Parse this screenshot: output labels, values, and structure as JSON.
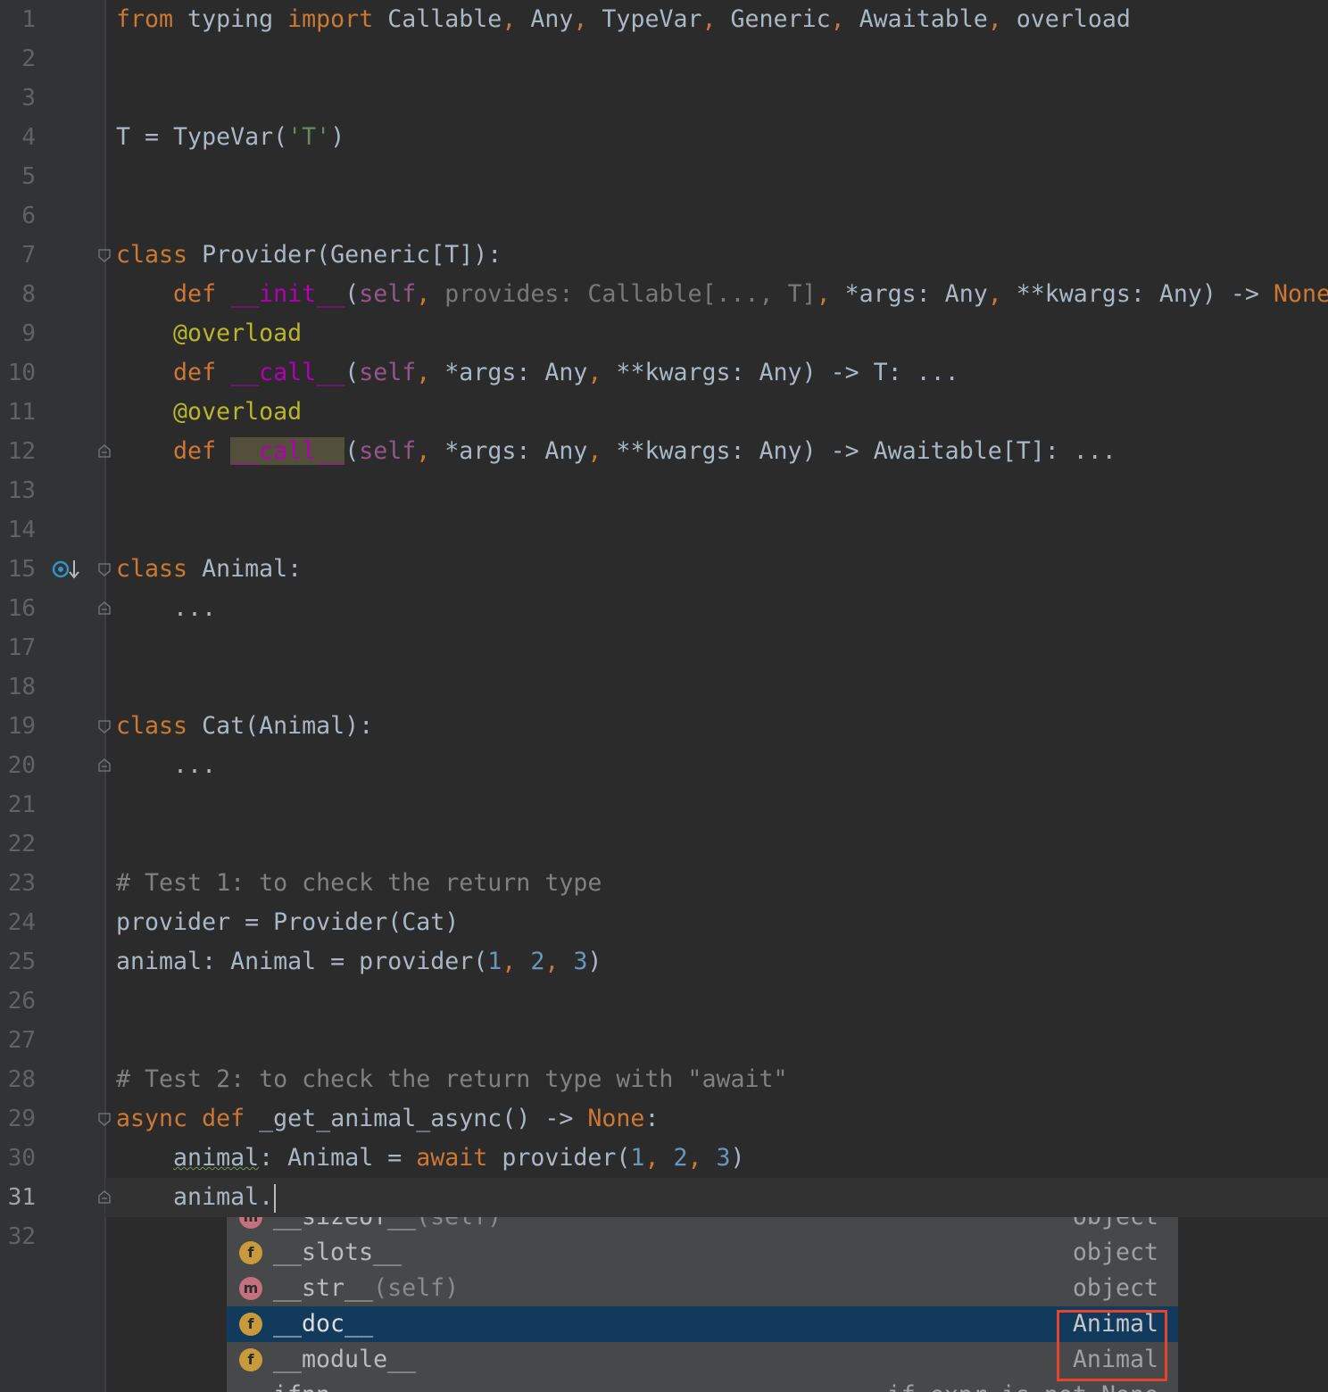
{
  "editor": {
    "line_numbers": [
      "1",
      "2",
      "3",
      "4",
      "5",
      "6",
      "7",
      "8",
      "9",
      "10",
      "11",
      "12",
      "13",
      "14",
      "15",
      "16",
      "17",
      "18",
      "19",
      "20",
      "21",
      "22",
      "23",
      "24",
      "25",
      "26",
      "27",
      "28",
      "29",
      "30",
      "31",
      "32"
    ],
    "current_line": "31",
    "lines": [
      [
        {
          "t": "from",
          "c": "kw"
        },
        {
          "t": " typing "
        },
        {
          "t": "import",
          "c": "kw"
        },
        {
          "t": " Callable"
        },
        {
          "t": ",",
          "c": "kw"
        },
        {
          "t": " Any"
        },
        {
          "t": ",",
          "c": "kw"
        },
        {
          "t": " TypeVar"
        },
        {
          "t": ",",
          "c": "kw"
        },
        {
          "t": " Generic"
        },
        {
          "t": ",",
          "c": "kw"
        },
        {
          "t": " Awaitable"
        },
        {
          "t": ",",
          "c": "kw"
        },
        {
          "t": " overload"
        }
      ],
      [],
      [],
      [
        {
          "t": "T = TypeVar("
        },
        {
          "t": "'T'",
          "c": "str"
        },
        {
          "t": ")"
        }
      ],
      [],
      [],
      [
        {
          "t": "class",
          "c": "kw"
        },
        {
          "t": " Provider(Generic[T]):"
        }
      ],
      [
        {
          "t": "    "
        },
        {
          "t": "def",
          "c": "kw"
        },
        {
          "t": " "
        },
        {
          "t": "__init__",
          "c": "magic"
        },
        {
          "t": "("
        },
        {
          "t": "self",
          "c": "self"
        },
        {
          "t": ",",
          "c": "kw"
        },
        {
          "t": " provides: Callable[..., T]",
          "c": "dim"
        },
        {
          "t": ",",
          "c": "kw"
        },
        {
          "t": " *args: Any"
        },
        {
          "t": ",",
          "c": "kw"
        },
        {
          "t": " **kwargs: Any) -> "
        },
        {
          "t": "None",
          "c": "kw"
        }
      ],
      [
        {
          "t": "    "
        },
        {
          "t": "@overload",
          "c": "dec"
        }
      ],
      [
        {
          "t": "    "
        },
        {
          "t": "def",
          "c": "kw"
        },
        {
          "t": " "
        },
        {
          "t": "__call__",
          "c": "magic"
        },
        {
          "t": "("
        },
        {
          "t": "self",
          "c": "self"
        },
        {
          "t": ",",
          "c": "kw"
        },
        {
          "t": " *args: Any"
        },
        {
          "t": ",",
          "c": "kw"
        },
        {
          "t": " **kwargs: Any) -> T: ..."
        }
      ],
      [
        {
          "t": "    "
        },
        {
          "t": "@overload",
          "c": "dec"
        }
      ],
      [
        {
          "t": "    "
        },
        {
          "t": "def",
          "c": "kw"
        },
        {
          "t": " "
        },
        {
          "t": "__call__",
          "c": "magic hl"
        },
        {
          "t": "("
        },
        {
          "t": "self",
          "c": "self"
        },
        {
          "t": ",",
          "c": "kw"
        },
        {
          "t": " *args: Any"
        },
        {
          "t": ",",
          "c": "kw"
        },
        {
          "t": " **kwargs: Any) -> Awaitable[T]: ..."
        }
      ],
      [],
      [],
      [
        {
          "t": "class",
          "c": "kw"
        },
        {
          "t": " Animal:"
        }
      ],
      [
        {
          "t": "    ..."
        }
      ],
      [],
      [],
      [
        {
          "t": "class",
          "c": "kw"
        },
        {
          "t": " Cat(Animal):"
        }
      ],
      [
        {
          "t": "    ..."
        }
      ],
      [],
      [],
      [
        {
          "t": "# Test 1: to check the return type",
          "c": "cmt"
        }
      ],
      [
        {
          "t": "provider = Provider(Cat)"
        }
      ],
      [
        {
          "t": "animal: Animal = provider("
        },
        {
          "t": "1",
          "c": "num"
        },
        {
          "t": ",",
          "c": "kw"
        },
        {
          "t": " "
        },
        {
          "t": "2",
          "c": "num"
        },
        {
          "t": ",",
          "c": "kw"
        },
        {
          "t": " "
        },
        {
          "t": "3",
          "c": "num"
        },
        {
          "t": ")"
        }
      ],
      [],
      [],
      [
        {
          "t": "# Test 2: to check the return type with \"await\"",
          "c": "cmt"
        }
      ],
      [
        {
          "t": "async",
          "c": "kw"
        },
        {
          "t": " "
        },
        {
          "t": "def",
          "c": "kw"
        },
        {
          "t": " _get_animal_async() -> "
        },
        {
          "t": "None",
          "c": "kw"
        },
        {
          "t": ":"
        }
      ],
      [
        {
          "t": "    "
        },
        {
          "t": "animal",
          "c": "squig"
        },
        {
          "t": ": Animal = "
        },
        {
          "t": "await",
          "c": "kw"
        },
        {
          "t": " provider("
        },
        {
          "t": "1",
          "c": "num"
        },
        {
          "t": ",",
          "c": "kw"
        },
        {
          "t": " "
        },
        {
          "t": "2",
          "c": "num"
        },
        {
          "t": ",",
          "c": "kw"
        },
        {
          "t": " "
        },
        {
          "t": "3",
          "c": "num"
        },
        {
          "t": ")"
        }
      ],
      [
        {
          "t": "    animal."
        }
      ],
      []
    ]
  },
  "completion_popup": {
    "items": [
      {
        "icon": "m",
        "name": "__sizeof__",
        "sig": "(self)",
        "type": "object",
        "selected": false
      },
      {
        "icon": "f",
        "name": "__slots__",
        "sig": "",
        "type": "object",
        "selected": false
      },
      {
        "icon": "m",
        "name": "__str__",
        "sig": "(self)",
        "type": "object",
        "selected": false
      },
      {
        "icon": "f",
        "name": "__doc__",
        "sig": "",
        "type": "Animal",
        "selected": true
      },
      {
        "icon": "f",
        "name": "__module__",
        "sig": "",
        "type": "Animal",
        "selected": false
      },
      {
        "icon": "",
        "name": "ifnn",
        "sig": "",
        "type": "if expr is not None",
        "selected": false
      }
    ]
  },
  "colors": {
    "background": "#2b2b2b",
    "keyword": "#cc7832",
    "decorator": "#bbb529",
    "magic_method": "#b200b2",
    "string": "#6a8759",
    "number": "#6897bb",
    "comment": "#808080",
    "selection": "#113a5c",
    "highlight_box": "#e5432e"
  }
}
